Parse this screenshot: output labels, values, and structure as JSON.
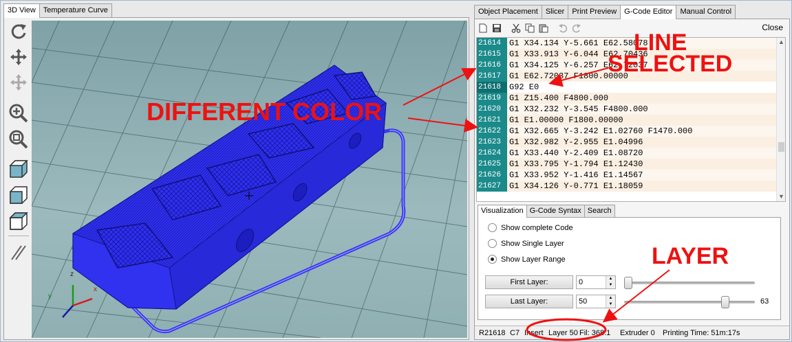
{
  "left_tabs": [
    "3D View",
    "Temperature Curve"
  ],
  "right_tabs": [
    "Object Placement",
    "Slicer",
    "Print Preview",
    "G-Code Editor",
    "Manual Control"
  ],
  "left_toolbar_icons": [
    "rotate-icon",
    "move-icon",
    "move-object-icon",
    "zoom-in-icon",
    "zoom-fit-icon",
    "iso-view-icon",
    "front-view-icon",
    "top-view-icon",
    "parallel-lines-icon"
  ],
  "editor": {
    "toolbar_icons": [
      "new-file-icon",
      "save-icon",
      "cut-icon",
      "copy-icon",
      "paste-icon",
      "undo-icon",
      "redo-icon"
    ],
    "close_label": "Close",
    "lines": [
      {
        "n": "21614",
        "code": "G1 X34.134 Y-5.661 E62.58078"
      },
      {
        "n": "21615",
        "code": "G1 X33.913 Y-6.044 E62.70436"
      },
      {
        "n": "21616",
        "code": "G1 X34.125 Y-6.257 E62.72037"
      },
      {
        "n": "21617",
        "code": "G1 E62.72037 F1800.00000"
      },
      {
        "n": "21618",
        "code": "G92 E0"
      },
      {
        "n": "21619",
        "code": "G1 Z15.400 F4800.000"
      },
      {
        "n": "21620",
        "code": "G1 X32.232 Y-3.545 F4800.000"
      },
      {
        "n": "21621",
        "code": "G1 E1.00000 F1800.00000"
      },
      {
        "n": "21622",
        "code": "G1 X32.665 Y-3.242 E1.02760 F1470.000"
      },
      {
        "n": "21623",
        "code": "G1 X32.982 Y-2.955 E1.04996"
      },
      {
        "n": "21624",
        "code": "G1 X33.440 Y-2.409 E1.08720"
      },
      {
        "n": "21625",
        "code": "G1 X33.795 Y-1.794 E1.12430"
      },
      {
        "n": "21626",
        "code": "G1 X33.952 Y-1.416 E1.14567"
      },
      {
        "n": "21627",
        "code": "G1 X34.126 Y-0.771 E1.18059"
      }
    ],
    "selected_line": "21618"
  },
  "sub_tabs": [
    "Visualization",
    "G-Code Syntax",
    "Search"
  ],
  "visualization": {
    "options": [
      "Show complete Code",
      "Show Single Layer",
      "Show Layer Range"
    ],
    "selected_option": "Show Layer Range",
    "first_layer_label": "First Layer:",
    "first_layer_value": "0",
    "last_layer_label": "Last Layer:",
    "last_layer_value": "50",
    "first_slider_fraction": 0.0,
    "last_slider_fraction": 0.79,
    "slider_max_label": "63"
  },
  "status_bar": {
    "row": "R21618",
    "col": "C7",
    "mode": "Insert",
    "layer": "Layer 50",
    "fil": "Fil: 368.1",
    "extruder": "Extruder 0",
    "print_time": "Printing Time: 51m:17s"
  },
  "annotations": {
    "line_selected": [
      "LINE",
      "SELECTED"
    ],
    "different_color": "DIFFERENT COLOR",
    "layer": "LAYER"
  },
  "colors": {
    "line_number_bg": "#1b8a8a",
    "line_number_selected_bg": "#0f6f6f",
    "selected_row_bg": "#ffffff",
    "row_even_bg": "#fdf6ee",
    "row_odd_bg": "#fbefe2",
    "model_blue": "#2e2ff0",
    "annotation_red": "#ee1111"
  }
}
